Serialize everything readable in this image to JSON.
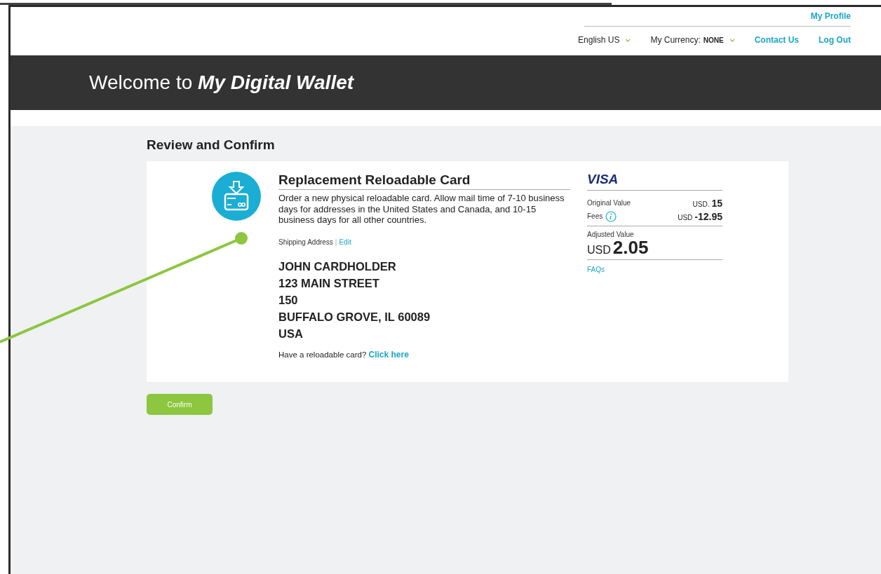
{
  "header": {
    "profile_link": "My Profile",
    "nav": [
      {
        "kind": "dropdown",
        "label": "English US"
      },
      {
        "kind": "currency",
        "label": "My Currency:",
        "value": "NONE"
      },
      {
        "kind": "link",
        "label": "Contact Us"
      },
      {
        "kind": "link",
        "label": "Log Out"
      }
    ]
  },
  "banner": {
    "prefix": "Welcome to",
    "emphasis": "My Digital Wallet"
  },
  "section_title": "Review and Confirm",
  "product": {
    "title": "Replacement Reloadable Card",
    "description": "Order a new physical reloadable card. Allow mail time of 7-10 business days for addresses in the United States and Canada, and 10-15 business days for all other countries.",
    "shipping_label": "Shipping Address",
    "separator": "|",
    "edit_link": "Edit",
    "address": [
      "JOHN CARDHOLDER",
      "123 MAIN STREET",
      "150",
      "BUFFALO GROVE, IL 60089",
      "USA"
    ],
    "reload_prompt": "Have a reloadable card?",
    "reload_link": "Click here"
  },
  "summary": {
    "brand": "VISA",
    "lines": [
      {
        "label": "Original Value",
        "info": false,
        "currency": "USD.",
        "amount": "15"
      },
      {
        "label": "Fees",
        "info": true,
        "currency": "USD",
        "amount": "-12.95"
      }
    ],
    "adjusted_label": "Adjusted Value",
    "adjusted_currency": "USD",
    "adjusted_amount": "2.05",
    "faq_link": "FAQs"
  },
  "confirm_button": "Confirm"
}
